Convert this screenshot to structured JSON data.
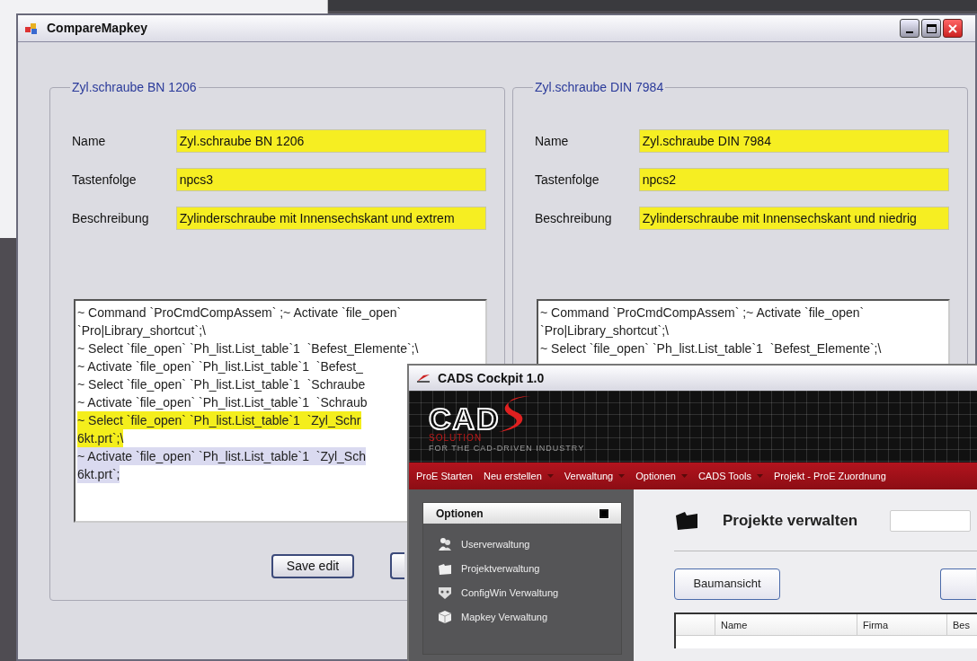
{
  "compare_window": {
    "title": "CompareMapkey",
    "groups": [
      {
        "legend": "Zyl.schraube BN 1206",
        "fields": [
          {
            "label": "Name",
            "value": "Zyl.schraube BN 1206"
          },
          {
            "label": "Tastenfolge",
            "value": "npcs3"
          },
          {
            "label": "Beschreibung",
            "value": "Zylinderschraube mit Innensechskant und extrem"
          }
        ],
        "lines": [
          {
            "text": "~ Command `ProCmdCompAssem` ;~ Activate `file_open`",
            "kind": "plain"
          },
          {
            "text": "`Pro|Library_shortcut`;\\",
            "kind": "plain"
          },
          {
            "text": "~ Select `file_open` `Ph_list.List_table`1  `Befest_Elemente`;\\",
            "kind": "plain"
          },
          {
            "text": "~ Activate `file_open` `Ph_list.List_table`1  `Befest_",
            "kind": "plain"
          },
          {
            "text": "~ Select `file_open` `Ph_list.List_table`1  `Schraube",
            "kind": "plain"
          },
          {
            "text": "~ Activate `file_open` `Ph_list.List_table`1  `Schraub",
            "kind": "plain"
          },
          {
            "text": "~ Select `file_open` `Ph_list.List_table`1  `Zyl_Schr",
            "kind": "highlighted"
          },
          {
            "text": "6kt.prt`;\\",
            "kind": "highlighted"
          },
          {
            "text": "~ Activate `file_open` `Ph_list.List_table`1  `Zyl_Sch",
            "kind": "selected"
          },
          {
            "text": "6kt.prt`;",
            "kind": "selected"
          }
        ],
        "buttons": [
          "Save edit"
        ]
      },
      {
        "legend": "Zyl.schraube DIN 7984",
        "fields": [
          {
            "label": "Name",
            "value": "Zyl.schraube DIN 7984"
          },
          {
            "label": "Tastenfolge",
            "value": "npcs2"
          },
          {
            "label": "Beschreibung",
            "value": "Zylinderschraube mit Innensechskant und niedrig"
          }
        ],
        "lines": [
          {
            "text": "~ Command `ProCmdCompAssem` ;~ Activate `file_open`",
            "kind": "plain"
          },
          {
            "text": "`Pro|Library_shortcut`;\\",
            "kind": "plain"
          },
          {
            "text": "~ Select `file_open` `Ph_list.List_table`1  `Befest_Elemente`;\\",
            "kind": "plain"
          }
        ]
      }
    ]
  },
  "cockpit_window": {
    "title": "CADS Cockpit 1.0",
    "logo": {
      "main": "CAD",
      "sub": "SOLUTION",
      "tagline": "FOR THE CAD-DRIVEN INDUSTRY"
    },
    "menu": [
      {
        "label": "ProE Starten",
        "dropdown": false
      },
      {
        "label": "Neu erstellen",
        "dropdown": true
      },
      {
        "label": "Verwaltung",
        "dropdown": true
      },
      {
        "label": "Optionen",
        "dropdown": true
      },
      {
        "label": "CADS Tools",
        "dropdown": true
      },
      {
        "label": "Projekt - ProE Zuordnung",
        "dropdown": false
      }
    ],
    "sidebar": {
      "title": "Optionen",
      "items": [
        {
          "label": "Userverwaltung",
          "kind": "users"
        },
        {
          "label": "Projektverwaltung",
          "kind": "folder"
        },
        {
          "label": "ConfigWin Verwaltung",
          "kind": "shield"
        },
        {
          "label": "Mapkey Verwaltung",
          "kind": "cube"
        }
      ]
    },
    "main": {
      "heading": "Projekte verwalten",
      "buttons": [
        "Baumansicht"
      ],
      "table": {
        "columns": [
          "",
          "Name",
          "Firma",
          "Bes"
        ]
      }
    }
  }
}
